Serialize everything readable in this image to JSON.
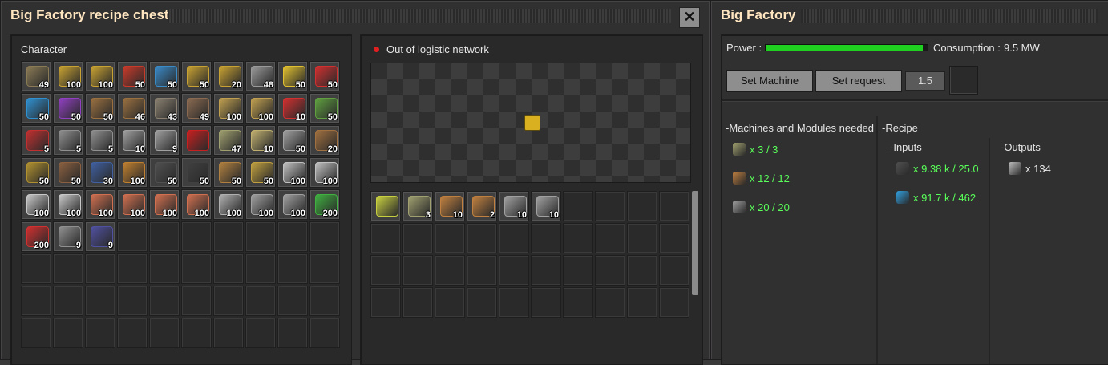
{
  "chest": {
    "title": "Big Factory recipe chest",
    "close_glyph": "✕",
    "character_label": "Character",
    "character_slots": [
      {
        "icon": "cable-reel-icon",
        "count": "49",
        "color": "#8a7a55"
      },
      {
        "icon": "transport-belt-icon",
        "count": "100",
        "color": "#c8a232"
      },
      {
        "icon": "transport-belt-icon",
        "count": "100",
        "color": "#c8a232"
      },
      {
        "icon": "fast-transport-belt-icon",
        "count": "50",
        "color": "#c83a2a"
      },
      {
        "icon": "express-transport-belt-icon",
        "count": "50",
        "color": "#3a8ac8"
      },
      {
        "icon": "underground-belt-icon",
        "count": "50",
        "color": "#c8a232"
      },
      {
        "icon": "splitter-icon",
        "count": "20",
        "color": "#c8a232"
      },
      {
        "icon": "chest-icon",
        "count": "48",
        "color": "#9a9a9a"
      },
      {
        "icon": "inserter-icon",
        "count": "50",
        "color": "#e0c030"
      },
      {
        "icon": "fast-inserter-icon",
        "count": "50",
        "color": "#d03030"
      },
      {
        "icon": "filter-inserter-icon",
        "count": "50",
        "color": "#3090d0"
      },
      {
        "icon": "stack-inserter-icon",
        "count": "50",
        "color": "#9040c0"
      },
      {
        "icon": "small-pole-icon",
        "count": "50",
        "color": "#9a7040"
      },
      {
        "icon": "medium-pole-icon",
        "count": "46",
        "color": "#9a7040"
      },
      {
        "icon": "big-pole-icon",
        "count": "43",
        "color": "#8a8070"
      },
      {
        "icon": "pipe-icon",
        "count": "49",
        "color": "#8a6a50"
      },
      {
        "icon": "rail-icon",
        "count": "100",
        "color": "#c0a050"
      },
      {
        "icon": "rail-icon",
        "count": "100",
        "color": "#c0a050"
      },
      {
        "icon": "red-inserter-icon",
        "count": "10",
        "color": "#d03030"
      },
      {
        "icon": "signal-icon",
        "count": "50",
        "color": "#60a040"
      },
      {
        "icon": "locomotive-icon",
        "count": "5",
        "color": "#c03030"
      },
      {
        "icon": "cargo-wagon-icon",
        "count": "5",
        "color": "#909090"
      },
      {
        "icon": "fluid-wagon-icon",
        "count": "5",
        "color": "#909090"
      },
      {
        "icon": "construction-robot-icon",
        "count": "10",
        "color": "#a0a0a0"
      },
      {
        "icon": "logistic-robot-icon",
        "count": "9",
        "color": "#a0a0a0"
      },
      {
        "icon": "red-wall-icon",
        "count": "",
        "color": "#c82020"
      },
      {
        "icon": "assembler-icon",
        "count": "47",
        "color": "#a0a070"
      },
      {
        "icon": "chemical-plant-icon",
        "count": "10",
        "color": "#c0b070"
      },
      {
        "icon": "oil-refinery-icon",
        "count": "50",
        "color": "#a0a0a0"
      },
      {
        "icon": "pumpjack-icon",
        "count": "20",
        "color": "#a07040"
      },
      {
        "icon": "burner-drill-icon",
        "count": "50",
        "color": "#b09030"
      },
      {
        "icon": "mining-drill-icon",
        "count": "50",
        "color": "#8a6040"
      },
      {
        "icon": "lab-icon",
        "count": "30",
        "color": "#4060a0"
      },
      {
        "icon": "coal-icon",
        "count": "100",
        "color": "#c08030"
      },
      {
        "icon": "stone-icon",
        "count": "50",
        "color": "#505050"
      },
      {
        "icon": "iron-ore-icon",
        "count": "50",
        "color": "#404040"
      },
      {
        "icon": "copper-ore-icon",
        "count": "50",
        "color": "#b08040"
      },
      {
        "icon": "gold-ore-icon",
        "count": "50",
        "color": "#c0a040"
      },
      {
        "icon": "iron-plate-icon",
        "count": "100",
        "color": "#c0c0c0"
      },
      {
        "icon": "iron-plate-icon",
        "count": "100",
        "color": "#c0c0c0"
      },
      {
        "icon": "steel-plate-icon",
        "count": "100",
        "color": "#c8c8c8"
      },
      {
        "icon": "steel-plate-icon",
        "count": "100",
        "color": "#c8c8c8"
      },
      {
        "icon": "copper-plate-icon",
        "count": "100",
        "color": "#d07050"
      },
      {
        "icon": "copper-plate-icon",
        "count": "100",
        "color": "#d07050"
      },
      {
        "icon": "copper-plate-icon",
        "count": "100",
        "color": "#d07050"
      },
      {
        "icon": "copper-plate-icon",
        "count": "100",
        "color": "#d07050"
      },
      {
        "icon": "iron-stick-icon",
        "count": "100",
        "color": "#b0b0b0"
      },
      {
        "icon": "iron-gear-icon",
        "count": "100",
        "color": "#a0a0a0"
      },
      {
        "icon": "iron-gear-icon",
        "count": "100",
        "color": "#a0a0a0"
      },
      {
        "icon": "electronic-circuit-icon",
        "count": "200",
        "color": "#40b040"
      },
      {
        "icon": "advanced-circuit-icon",
        "count": "200",
        "color": "#d03030"
      },
      {
        "icon": "engine-icon",
        "count": "9",
        "color": "#909090"
      },
      {
        "icon": "battery-icon",
        "count": "9",
        "color": "#5050a0"
      }
    ],
    "total_character_slots": 90,
    "network_status": "Out of logistic network",
    "network_dot_color": "#e02020",
    "logistic_slots": [
      {
        "icon": "blueprint-icon",
        "count": "",
        "color": "#c8d040"
      },
      {
        "icon": "assembler-icon",
        "count": "3",
        "color": "#a0a070"
      },
      {
        "icon": "module-icon",
        "count": "10",
        "color": "#c08040"
      },
      {
        "icon": "module-icon",
        "count": "2",
        "color": "#c08040"
      },
      {
        "icon": "beacon-icon",
        "count": "10",
        "color": "#a0a0a0"
      },
      {
        "icon": "beacon-icon",
        "count": "10",
        "color": "#a0a0a0"
      }
    ],
    "total_logistic_slots": 40
  },
  "factory": {
    "title": "Big Factory",
    "power_label": "Power :",
    "power_fill": 0.97,
    "power_bar_color": "#20d020",
    "consumption_label": "Consumption :",
    "consumption_value": "9.5 MW",
    "set_machine_label": "Set Machine",
    "set_request_label": "Set request",
    "request_value": "1.5",
    "machines_header": "-Machines and Modules needed",
    "machines": [
      {
        "icon": "assembler-icon",
        "text": "x 3 / 3",
        "color": "#a0a070"
      },
      {
        "icon": "module-icon",
        "text": "x 12 / 12",
        "color": "#c08040"
      },
      {
        "icon": "beacon-icon",
        "text": "x 20 / 20",
        "color": "#a0a0a0"
      }
    ],
    "recipe_header": "-Recipe",
    "inputs_header": "-Inputs",
    "inputs": [
      {
        "icon": "coal-icon",
        "text": "x 9.38 k / 25.0",
        "color": "#505050"
      },
      {
        "icon": "water-icon",
        "text": "x 91.7 k / 462",
        "color": "#30a0e0"
      }
    ],
    "outputs_header": "-Outputs",
    "outputs": [
      {
        "icon": "iron-plate-icon",
        "text": "x 134",
        "color": "#c0c0c0"
      }
    ]
  }
}
